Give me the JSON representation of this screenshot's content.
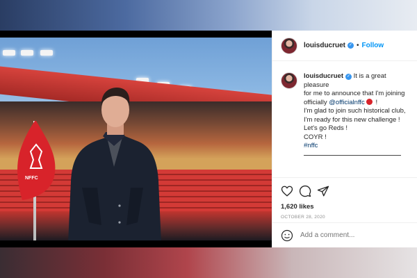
{
  "post": {
    "username": "louisducruet",
    "follow_label": "Follow",
    "separator": "•",
    "caption_lines": [
      "It is a great pleasure",
      "for me to announce that I'm joining",
      "officially"
    ],
    "caption_mention": "@officialnffc",
    "caption_after_mention": "!",
    "caption_rest": [
      "I'm glad to join such historical club,",
      "I'm ready for this new challenge !",
      "Let's go Reds !",
      "COYR !"
    ],
    "hashtag": "#nffc",
    "likes": "1,620 likes",
    "date": "OCTOBER 28, 2020",
    "comment_placeholder": "Add a comment..."
  },
  "icons": {
    "verified": "verified-badge-icon",
    "like": "heart-icon",
    "comment": "comment-bubble-icon",
    "share": "paper-plane-icon",
    "emoji": "smiley-icon"
  },
  "colors": {
    "follow_blue": "#0095f6",
    "verified_blue": "#3897f0",
    "club_red": "#d8232a"
  }
}
